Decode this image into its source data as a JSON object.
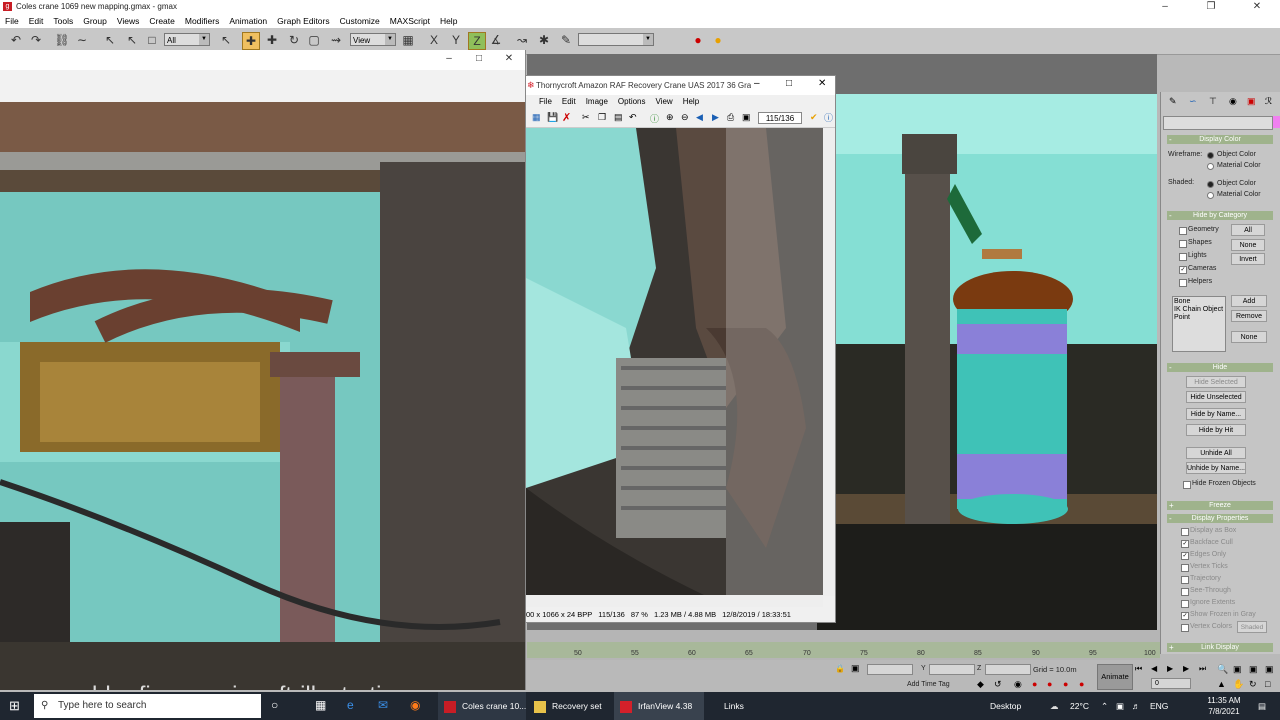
{
  "app": {
    "title": "Coles crane 1069 new mapping.gmax - gmax",
    "menu": [
      "File",
      "Edit",
      "Tools",
      "Group",
      "Views",
      "Create",
      "Modifiers",
      "Animation",
      "Graph Editors",
      "Customize",
      "MAXScript",
      "Help"
    ],
    "selection_filter": "All",
    "ref_coord": "View"
  },
  "photo_window": {
    "watermark": "www.grubby-fingers-aircraft-illustration.com"
  },
  "irfan_window": {
    "title": "Thornycroft Amazon RAF Recovery Crane UAS 2017 36 Gra...",
    "menu": [
      "File",
      "Edit",
      "Image",
      "Options",
      "View",
      "Help"
    ],
    "page_counter": "115/136",
    "status": [
      "00 x 1066 x 24 BPP",
      "115/136",
      "87 %",
      "1.23 MB / 4.88 MB",
      "12/8/2019 / 18:33:51"
    ]
  },
  "command_panel": {
    "display_color": {
      "header": "Display Color",
      "wireframe_label": "Wireframe:",
      "shaded_label": "Shaded:",
      "object_color": "Object Color",
      "material_color": "Material Color"
    },
    "hide_by_category": {
      "header": "Hide by Category",
      "items": [
        {
          "label": "Geometry",
          "checked": false
        },
        {
          "label": "Shapes",
          "checked": false
        },
        {
          "label": "Lights",
          "checked": false
        },
        {
          "label": "Cameras",
          "checked": true
        },
        {
          "label": "Helpers",
          "checked": false
        }
      ],
      "btn_all": "All",
      "btn_none": "None",
      "btn_invert": "Invert",
      "list": [
        "Bone",
        "IK Chain Object",
        "Point"
      ],
      "btn_add": "Add",
      "btn_remove": "Remove",
      "btn_none2": "None"
    },
    "hide": {
      "header": "Hide",
      "hide_selected": "Hide Selected",
      "hide_unselected": "Hide Unselected",
      "hide_by_name": "Hide by Name...",
      "hide_by_hit": "Hide by Hit",
      "unhide_all": "Unhide All",
      "unhide_by_name": "Unhide by Name...",
      "hide_frozen": "Hide Frozen Objects"
    },
    "freeze_header": "Freeze",
    "display_properties": {
      "header": "Display Properties",
      "items": [
        "Display as Box",
        "Backface Cull",
        "Edges Only",
        "Vertex Ticks",
        "Trajectory",
        "See-Through",
        "Ignore Extents",
        "Show Frozen in Gray",
        "Vertex Colors"
      ],
      "shaded_btn": "Shaded"
    },
    "link_display_header": "Link Display"
  },
  "timeline": {
    "ticks": [
      "50",
      "55",
      "60",
      "65",
      "70",
      "75",
      "80",
      "85",
      "90",
      "95",
      "100"
    ]
  },
  "status_bar": {
    "y_label": "Y",
    "z_label": "Z",
    "grid": "Grid = 10.0m",
    "add_time_tag": "Add Time Tag",
    "animate": "Animate",
    "frame": "0"
  },
  "taskbar": {
    "search_placeholder": "Type here to search",
    "apps": [
      {
        "label": "Coles crane 10...",
        "color": "#c81d25"
      },
      {
        "label": "Recovery set",
        "color": "#e8c24a"
      },
      {
        "label": "IrfanView 4.38",
        "color": "#d4202a"
      }
    ],
    "links": "Links",
    "desktop": "Desktop",
    "temperature": "22°C",
    "lang": "ENG",
    "time": "11:35 AM",
    "date": "7/8/2021"
  }
}
